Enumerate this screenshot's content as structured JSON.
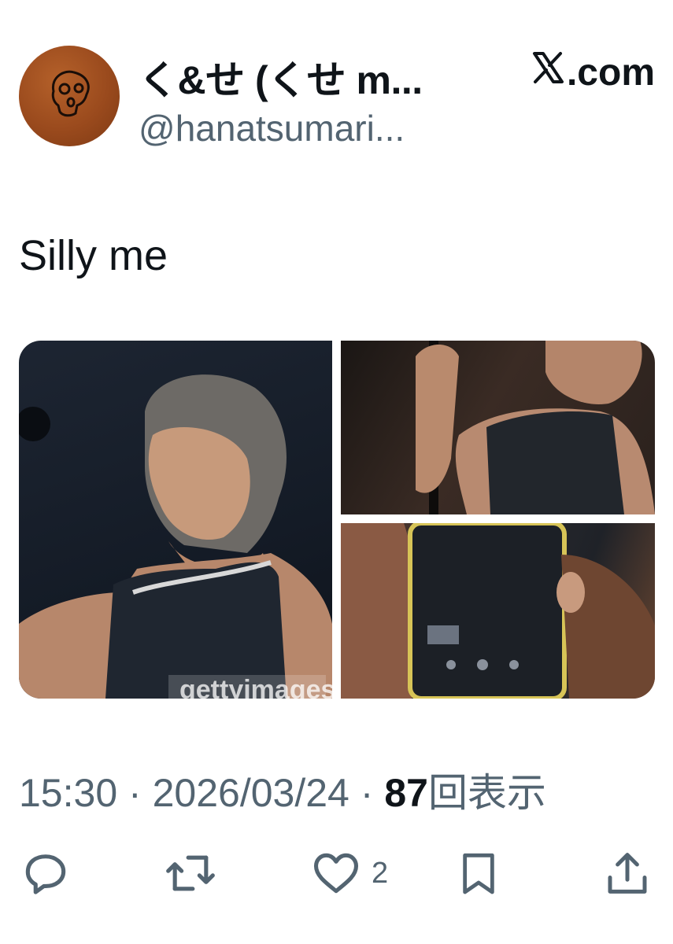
{
  "tweet": {
    "display_name": "く&せ (くせ m...",
    "handle": "@hanatsumari...",
    "source_label": ".com",
    "text": "Silly me",
    "time": "15:30",
    "date": "2026/03/24",
    "views_count": "87",
    "views_label": "回表示",
    "separator": "·",
    "media": [
      {
        "alt": "performer in black tank top on stage",
        "watermark": "gettyimages"
      },
      {
        "alt": "performer holding microphone stand"
      },
      {
        "alt": "hand holding phone"
      }
    ],
    "actions": {
      "reply_icon": "reply-icon",
      "retweet_icon": "retweet-icon",
      "like_icon": "heart-icon",
      "like_count": "2",
      "bookmark_icon": "bookmark-icon",
      "share_icon": "share-icon"
    }
  },
  "colors": {
    "text_primary": "#0f1419",
    "text_secondary": "#536471",
    "background": "#ffffff"
  }
}
